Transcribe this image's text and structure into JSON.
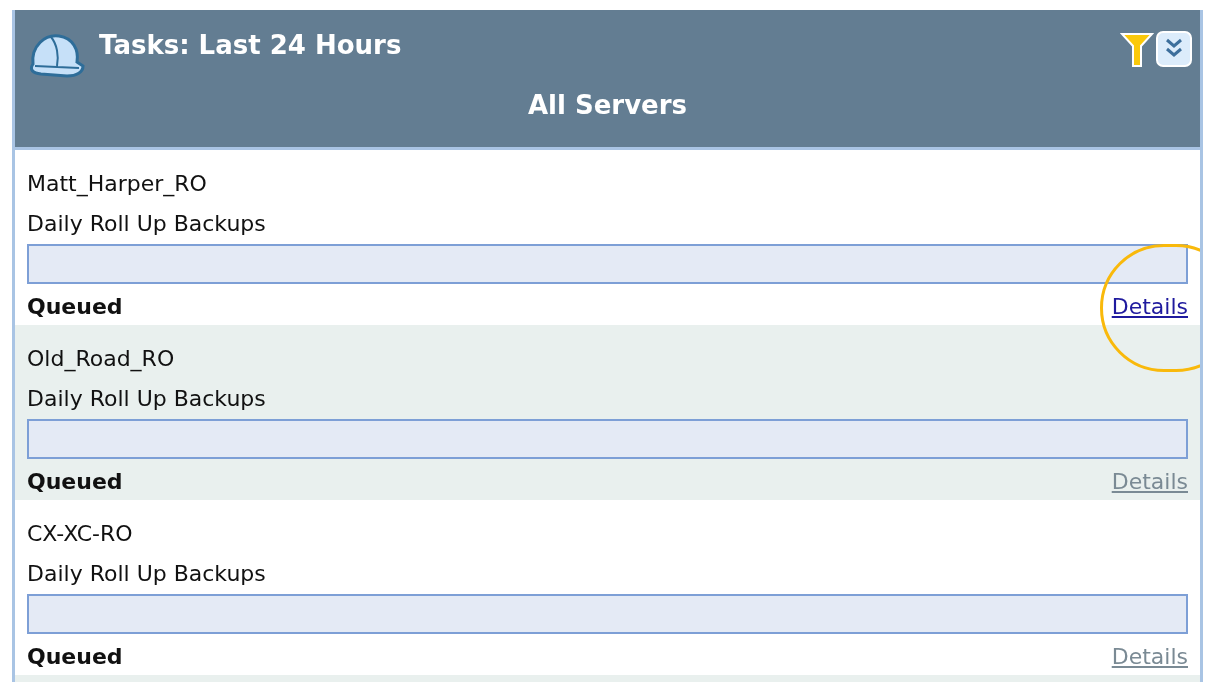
{
  "panel": {
    "title": "Tasks: Last 24 Hours",
    "subtitle": "All Servers"
  },
  "tasks": [
    {
      "server": "Matt_Harper_RO",
      "job": "Daily Roll Up Backups",
      "level": 0,
      "status": "Queued",
      "link": "Details",
      "link_active": true,
      "highlighted": true
    },
    {
      "server": "Old_Road_RO",
      "job": "Daily Roll Up Backups",
      "level": 0,
      "status": "Queued",
      "link": "Details",
      "link_active": false,
      "highlighted": false
    },
    {
      "server": "CX-XC-RO",
      "job": "Daily Roll Up Backups",
      "level": 0,
      "status": "Queued",
      "link": "Details",
      "link_active": false,
      "highlighted": false
    }
  ]
}
